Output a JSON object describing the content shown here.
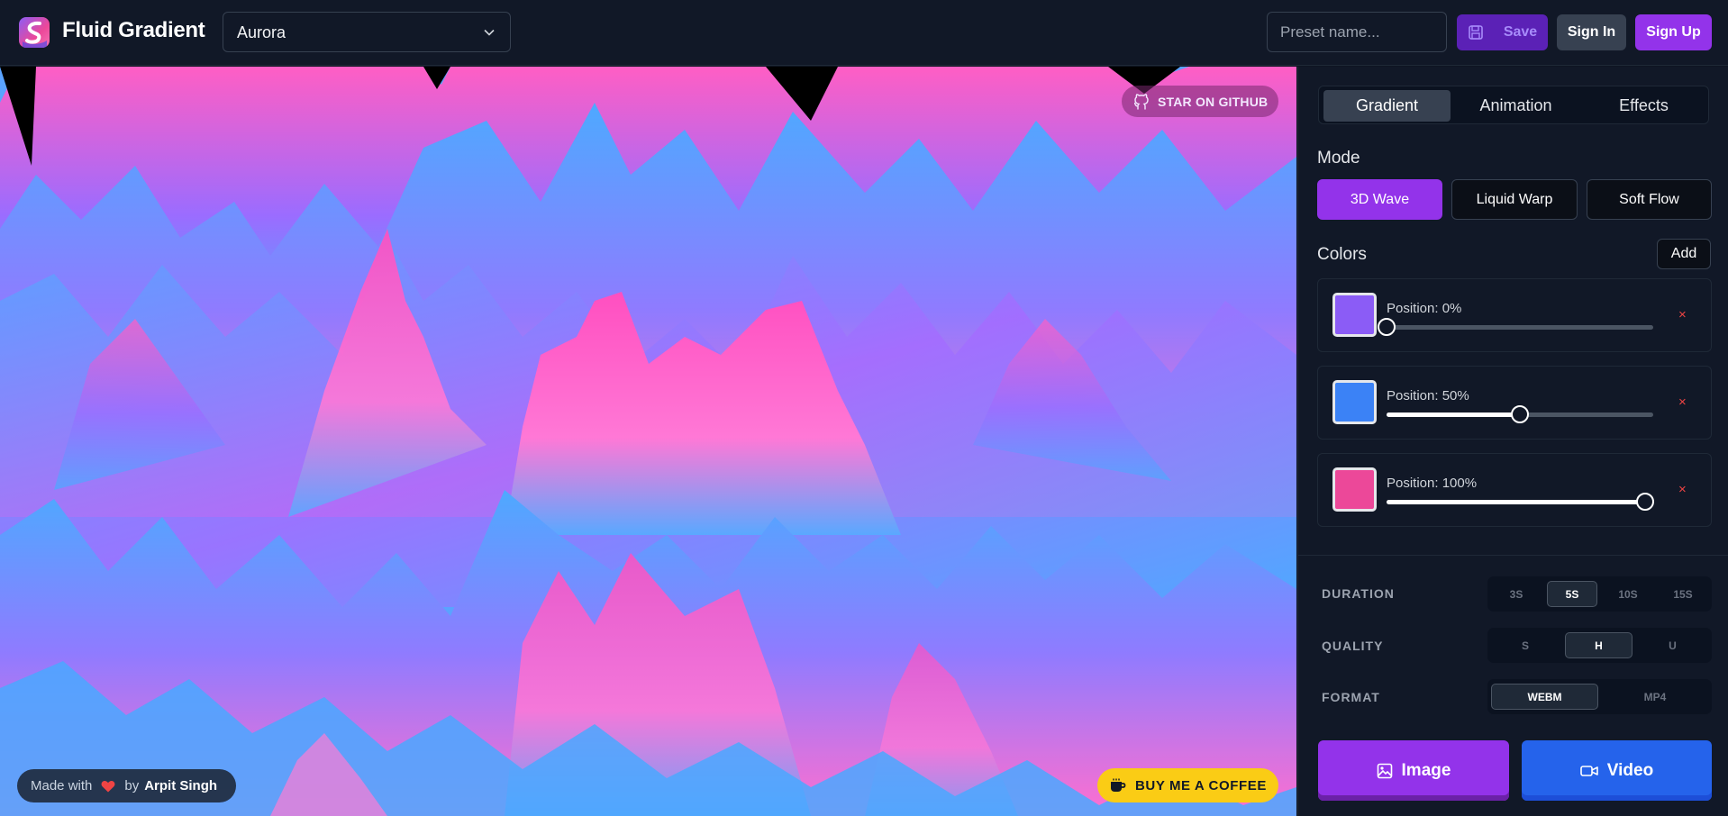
{
  "app": {
    "title": "Fluid Gradient",
    "logo_icon": "fluid-gradient-logo-icon"
  },
  "header": {
    "preset_selected": "Aurora",
    "preset_input_placeholder": "Preset name...",
    "save_label": "Save",
    "sign_in_label": "Sign In",
    "sign_up_label": "Sign Up"
  },
  "canvas": {
    "github_label": "STAR ON GITHUB",
    "made_with_prefix": "Made with",
    "made_with_by": "by",
    "author": "Arpit Singh",
    "coffee_label": "BUY ME A COFFEE",
    "colors": [
      "#ff5ec4",
      "#4ea9ff",
      "#9b6cff"
    ]
  },
  "panel": {
    "tabs": [
      {
        "label": "Gradient",
        "active": true
      },
      {
        "label": "Animation",
        "active": false
      },
      {
        "label": "Effects",
        "active": false
      }
    ],
    "mode_title": "Mode",
    "modes": [
      {
        "label": "3D Wave",
        "active": true
      },
      {
        "label": "Liquid Warp",
        "active": false
      },
      {
        "label": "Soft Flow",
        "active": false
      }
    ],
    "colors_title": "Colors",
    "add_label": "Add",
    "stops": [
      {
        "label": "Position: 0%",
        "color": "#8b5cf6",
        "position": 0
      },
      {
        "label": "Position: 50%",
        "color": "#3b82f6",
        "position": 50
      },
      {
        "label": "Position: 100%",
        "color": "#ec4899",
        "position": 100
      }
    ],
    "remove_glyph": "×",
    "duration": {
      "label": "DURATION",
      "options": [
        "3S",
        "5S",
        "10S",
        "15S"
      ],
      "selected": "5S"
    },
    "quality": {
      "label": "QUALITY",
      "options": [
        "S",
        "H",
        "U"
      ],
      "selected": "H"
    },
    "format": {
      "label": "FORMAT",
      "options": [
        "WEBM",
        "MP4"
      ],
      "selected": "WEBM"
    },
    "image_label": "Image",
    "video_label": "Video"
  }
}
